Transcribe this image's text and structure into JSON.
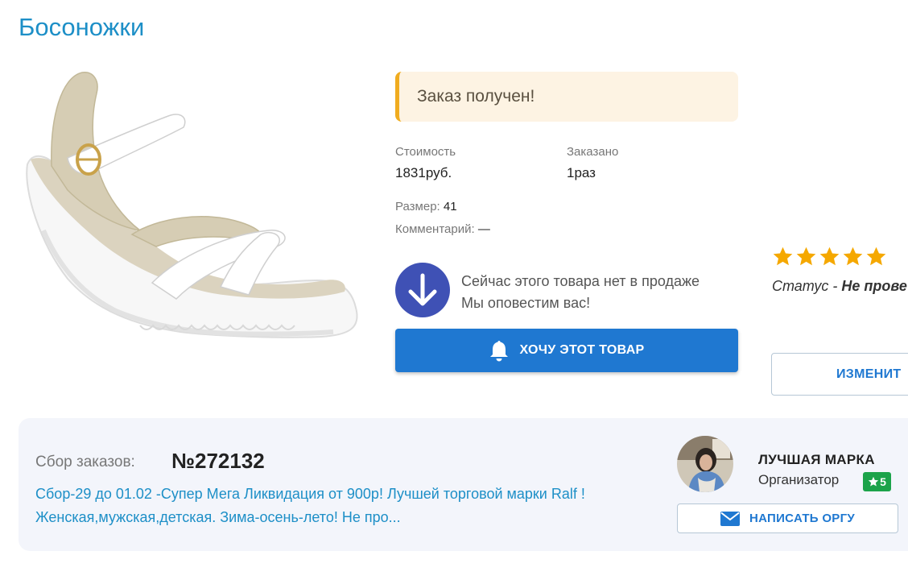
{
  "product": {
    "title": "Босоножки",
    "image_icon": "sandal-product-image"
  },
  "order": {
    "status_banner": "Заказ получен!",
    "price_label": "Стоимость",
    "price_value": "1831руб.",
    "ordered_label": "Заказано",
    "ordered_value": "1раз",
    "size_label": "Размер:",
    "size_value": "41",
    "comment_label": "Комментарий:",
    "comment_value": "—"
  },
  "availability": {
    "icon": "arrow-down-icon",
    "line1": "Сейчас этого товара нет в продаже",
    "line2": "Мы оповестим вас!",
    "want_button": "ХОЧУ ЭТОТ ТОВАР",
    "want_icon": "bell-icon"
  },
  "rating": {
    "stars": 5,
    "status_label": "Статус - ",
    "status_value": "Не прове"
  },
  "change_button": "ИЗМЕНИТ",
  "collection": {
    "label": "Сбор заказов:",
    "number": "№272132",
    "description": "Сбор-29 до 01.02 -Супер Мега Ликвидация от 900р! Лучшей торговой марки Ralf ! Женская,мужская,детская. Зима-осень-лето! Не про..."
  },
  "organizer": {
    "name": "ЛУЧШАЯ МАРКА",
    "role": "Организатор",
    "rating": "5",
    "write_button": "НАПИСАТЬ ОРГУ",
    "write_icon": "envelope-icon"
  },
  "colors": {
    "accent_blue": "#1f78d1",
    "title_blue": "#1d8fc7",
    "banner_border": "#f0ac1f",
    "banner_bg": "#fdf3e3",
    "circle_icon_bg": "#3f51b5",
    "star": "#f5a800",
    "rating_green": "#1ca34a"
  }
}
